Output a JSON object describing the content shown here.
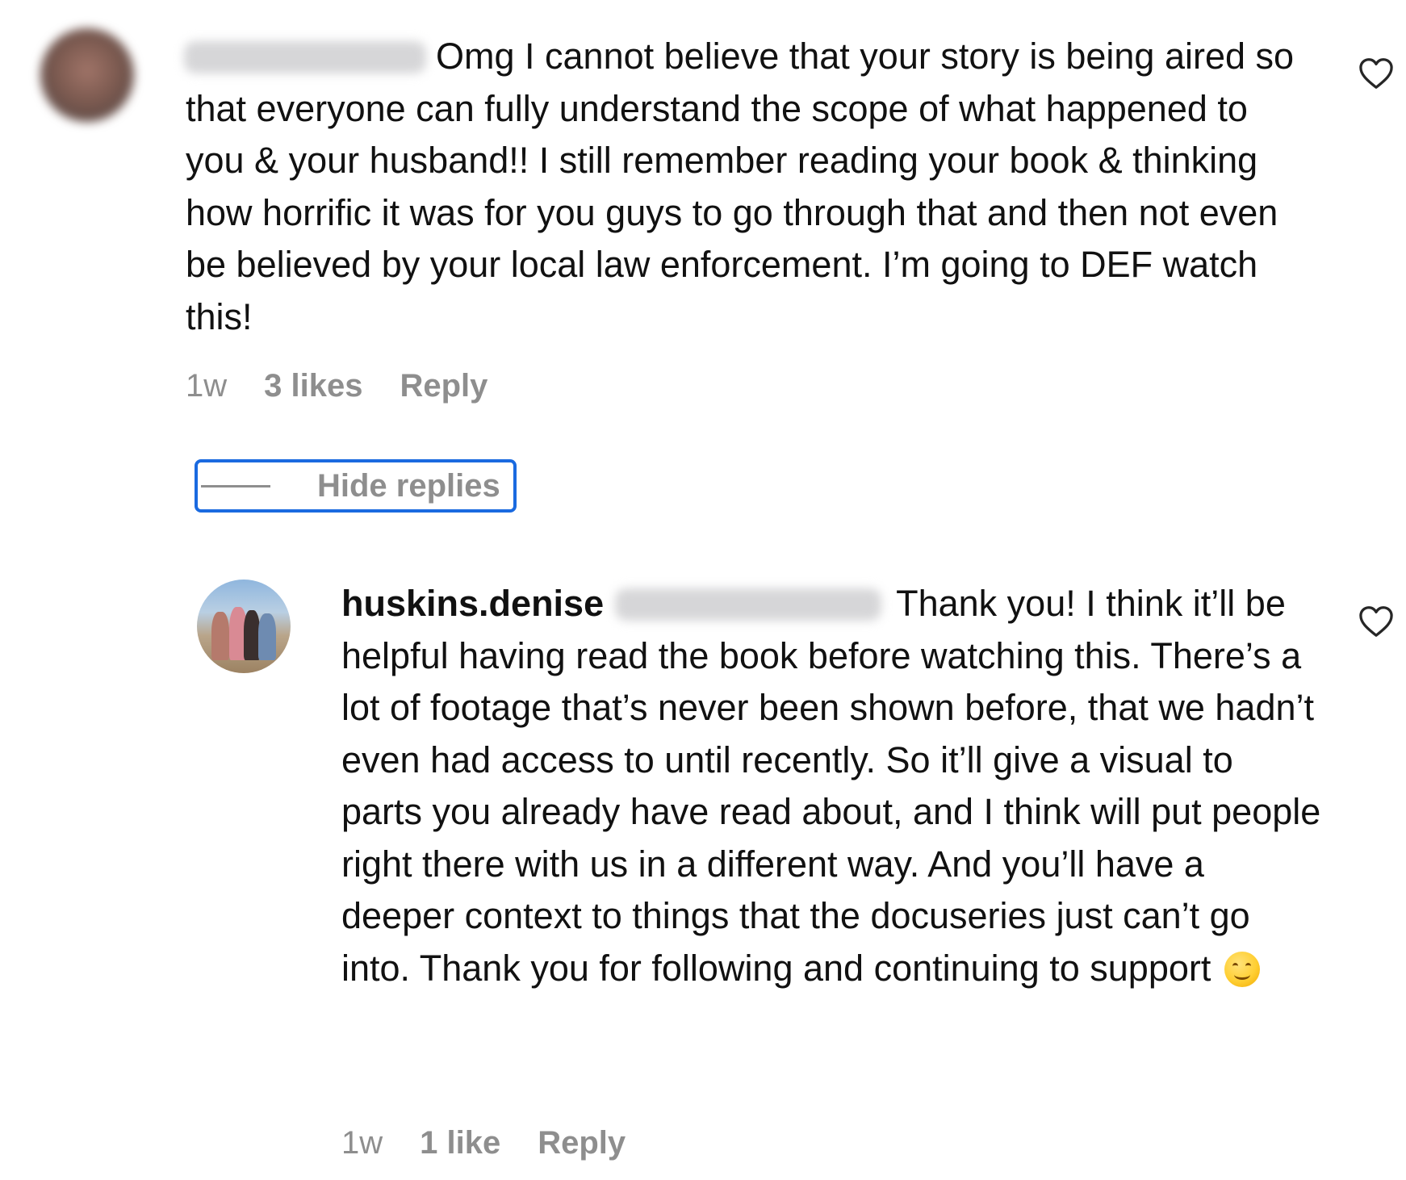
{
  "comment": {
    "text": "Omg I cannot believe that your story is being aired so that everyone can fully understand the scope of what happened to you & your husband!! I still remember reading your book & thinking how horrific it was for you guys to go through that and then not even be believed by your local law enforcement. I’m going to DEF watch this!",
    "time": "1w",
    "likes": "3 likes",
    "reply_label": "Reply",
    "like_icon": "heart-outline-icon"
  },
  "hide_replies_label": "Hide replies",
  "reply": {
    "username": "huskins.denise",
    "text": "Thank you! I think it’ll be helpful having read the book before watching this. There’s a lot of footage that’s never been shown before, that we hadn’t even had access to until recently. So it’ll give a visual to parts you already have read about, and I think will put people right there with us in a different way. And you’ll have a deeper context to things that the docuseries just can’t go into. Thank you for following and continuing to support",
    "emoji": "smiling-face-emoji",
    "time": "1w",
    "likes": "1 like",
    "reply_label": "Reply",
    "like_icon": "heart-outline-icon"
  }
}
